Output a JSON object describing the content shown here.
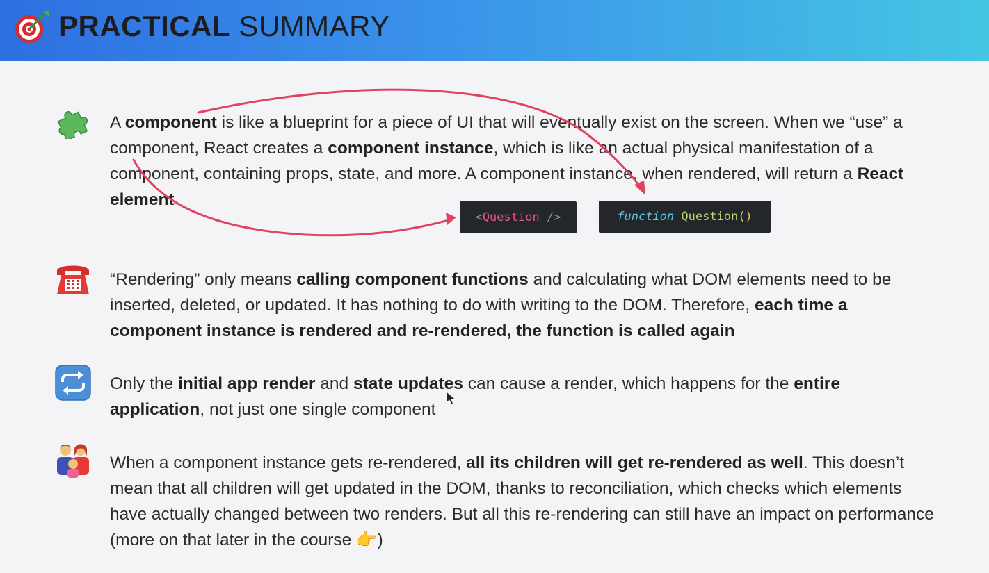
{
  "header": {
    "title_bold": "PRACTICAL",
    "title_light": " SUMMARY",
    "icon": "target-dart-icon"
  },
  "items": [
    {
      "icon": "puzzle-piece-icon",
      "segments": [
        {
          "t": "A ",
          "b": false
        },
        {
          "t": "component",
          "b": true
        },
        {
          "t": " is like a blueprint for a piece of UI that will eventually exist on the screen. When we “use” a component, React creates a ",
          "b": false
        },
        {
          "t": "component instance",
          "b": true
        },
        {
          "t": ", which is like an actual physical manifestation of a component, containing props, state, and more. A component instance, when rendered, will return a ",
          "b": false
        },
        {
          "t": "React element",
          "b": true
        }
      ]
    },
    {
      "icon": "telephone-icon",
      "segments": [
        {
          "t": "“Rendering” only means ",
          "b": false
        },
        {
          "t": "calling component functions",
          "b": true
        },
        {
          "t": " and calculating what DOM elements need to be inserted, deleted, or updated. It has nothing to do with writing to the DOM. Therefore, ",
          "b": false
        },
        {
          "t": "each time a component instance is rendered and re-rendered, the function is called again",
          "b": true
        }
      ]
    },
    {
      "icon": "repeat-arrows-icon",
      "segments": [
        {
          "t": "Only the ",
          "b": false
        },
        {
          "t": "initial app render",
          "b": true
        },
        {
          "t": " and ",
          "b": false
        },
        {
          "t": "state updates",
          "b": true
        },
        {
          "t": " can cause a render, which happens for the ",
          "b": false
        },
        {
          "t": "entire application",
          "b": true
        },
        {
          "t": ", not just one single component",
          "b": false
        }
      ]
    },
    {
      "icon": "family-icon",
      "segments": [
        {
          "t": "When a component instance gets re-rendered, ",
          "b": false
        },
        {
          "t": "all its children will get re-rendered as well",
          "b": true
        },
        {
          "t": ". This doesn’t mean that all children will get updated in the DOM, thanks to reconciliation, which checks which elements have actually changed between two renders. But all this re-rendering can still have an impact on performance (more on that later in the course ",
          "b": false
        },
        {
          "t": "👉",
          "b": false
        },
        {
          "t": ")",
          "b": false
        }
      ]
    }
  ],
  "code": {
    "tag_open": "<",
    "tag_name": "Question",
    "tag_close": " />",
    "fn_keyword": "function",
    "fn_name": " Question",
    "fn_parens": "()"
  },
  "colors": {
    "arrow": "#e0435f",
    "header_gradient_start": "#2d6fe0",
    "header_gradient_end": "#45c6e3",
    "code_bg": "#23262b"
  }
}
